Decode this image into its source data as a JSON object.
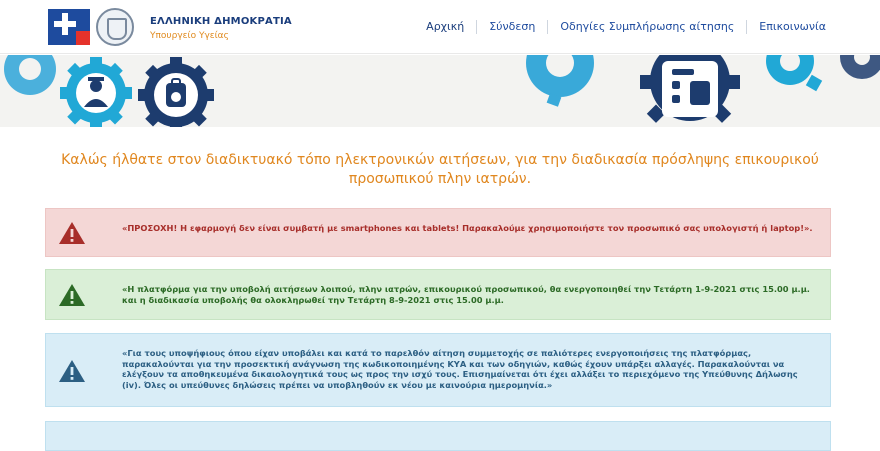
{
  "header": {
    "brand_title": "ΕΛΛΗΝΙΚΗ ΔΗΜΟΚΡΑΤΙΑ",
    "brand_subtitle": "Υπουργείο Υγείας"
  },
  "nav": {
    "items": [
      {
        "label": "Αρχική"
      },
      {
        "label": "Σύνδεση"
      },
      {
        "label": "Οδηγίες Συμπλήρωσης αίτησης"
      },
      {
        "label": "Επικοινωνία"
      }
    ]
  },
  "main": {
    "welcome": "Καλώς ήλθατε στον διαδικτυακό τόπο ηλεκτρονικών αιτήσεων, για την διαδικασία πρόσληψης επικουρικού προσωπικού πλην ιατρών.",
    "alerts": [
      {
        "text": "«ΠΡΟΣΟΧΗ! Η εφαρμογή δεν είναι συμβατή με smartphones και tablets! Παρακαλούμε χρησιμοποιήστε τον προσωπικό σας υπολογιστή ή laptop!».",
        "color": "#a72e2a"
      },
      {
        "text": "«Η πλατφόρμα για την υποβολή αιτήσεων λοιπού, πλην ιατρών, επικουρικού προσωπικού, θα ενεργοποιηθεί την Τετάρτη 1-9-2021 στις 15.00 μ.μ. και η διαδικασία υποβολής θα ολοκληρωθεί την Τετάρτη 8-9-2021 στις 15.00 μ.μ.",
        "color": "#2c6a26"
      },
      {
        "text": "«Για τους υποψήφιους όπου είχαν υποβάλει και κατά το παρελθόν αίτηση συμμετοχής σε παλιότερες ενεργοποιήσεις της πλατφόρμας, παρακαλούνται για την προσεκτική ανάγνωση της κωδικοποιημένης ΚΥΑ και των οδηγιών, καθώς έχουν υπάρξει αλλαγές. Παρακαλούνται να ελέγξουν τα αποθηκευμένα δικαιολογητικά τους ως προς την ισχύ τους. Επισημαίνεται ότι έχει αλλάξει το περιεχόμενο της Υπεύθυνης Δήλωσης (iv). Όλες οι υπεύθυνες δηλώσεις πρέπει να υποβληθούν εκ νέου με καινούρια ημερομηνία.»",
        "color": "#2c5f83"
      }
    ]
  },
  "colors": {
    "brand_blue": "#1e4b9e",
    "accent_orange": "#e0871f",
    "gear_dark": "#1d3c6e",
    "gear_teal": "#21a8d6"
  }
}
